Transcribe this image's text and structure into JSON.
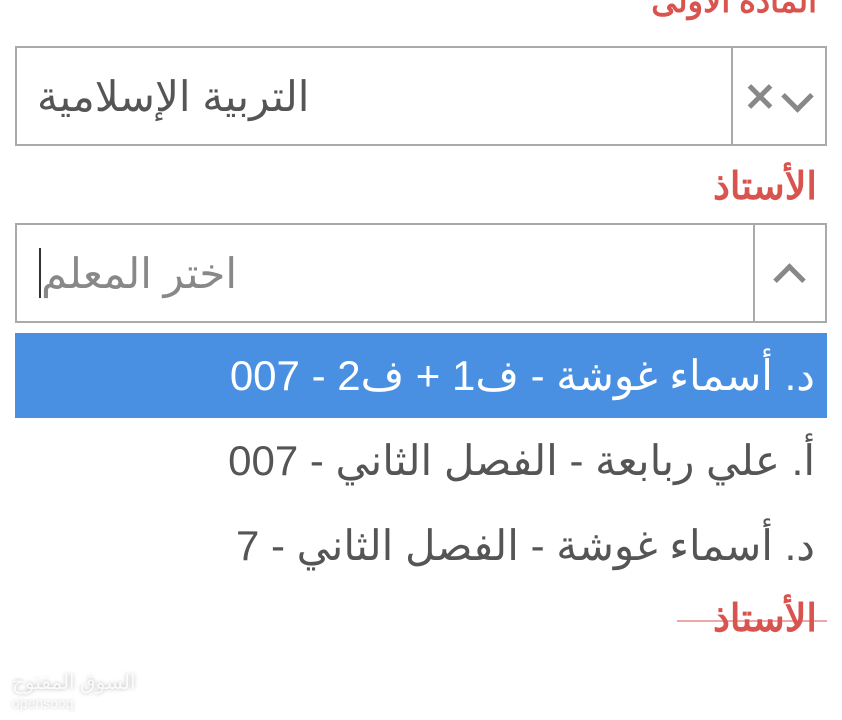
{
  "field1": {
    "label": "المادة الأولى",
    "selected": "التربية الإسلامية"
  },
  "field2": {
    "label": "الأستاذ",
    "placeholder": "اختر المعلم"
  },
  "options": [
    "د. أسماء غوشة - ف1 + ف2 - 007",
    "أ. علي ربابعة - الفصل الثاني - 007",
    "د. أسماء غوشة - الفصل الثاني - 7"
  ],
  "field3": {
    "label": "الأستاذ"
  },
  "watermark": {
    "line1": "السوق المفتوح",
    "line2": "opensooq"
  }
}
